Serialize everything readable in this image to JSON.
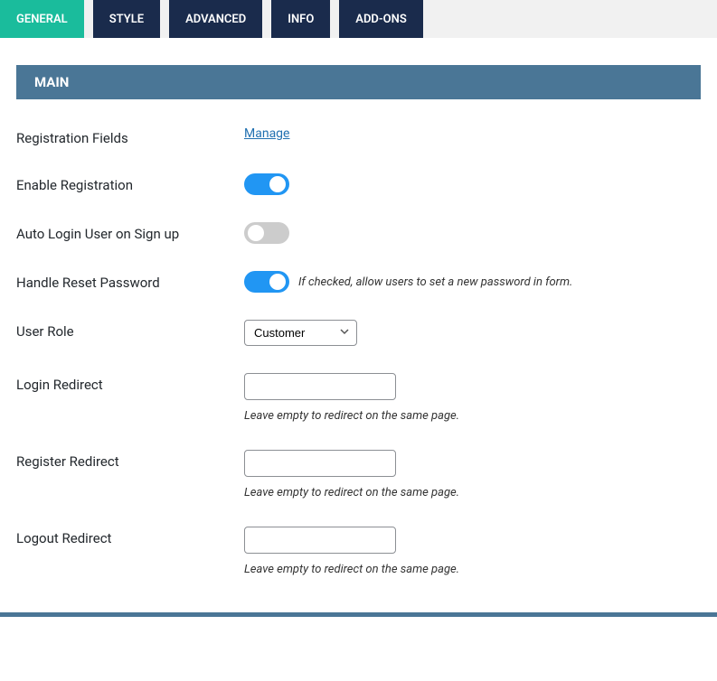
{
  "tabs": [
    {
      "label": "GENERAL",
      "active": true
    },
    {
      "label": "STYLE",
      "active": false
    },
    {
      "label": "ADVANCED",
      "active": false
    },
    {
      "label": "INFO",
      "active": false
    },
    {
      "label": "ADD-ONS",
      "active": false
    }
  ],
  "section_title": "MAIN",
  "fields": {
    "registration_fields": {
      "label": "Registration Fields",
      "link_text": "Manage"
    },
    "enable_registration": {
      "label": "Enable Registration",
      "value": true
    },
    "auto_login": {
      "label": "Auto Login User on Sign up",
      "value": false
    },
    "handle_reset_password": {
      "label": "Handle Reset Password",
      "value": true,
      "hint": "If checked, allow users to set a new password in form."
    },
    "user_role": {
      "label": "User Role",
      "selected": "Customer"
    },
    "login_redirect": {
      "label": "Login Redirect",
      "value": "",
      "hint": "Leave empty to redirect on the same page."
    },
    "register_redirect": {
      "label": "Register Redirect",
      "value": "",
      "hint": "Leave empty to redirect on the same page."
    },
    "logout_redirect": {
      "label": "Logout Redirect",
      "value": "",
      "hint": "Leave empty to redirect on the same page."
    }
  }
}
